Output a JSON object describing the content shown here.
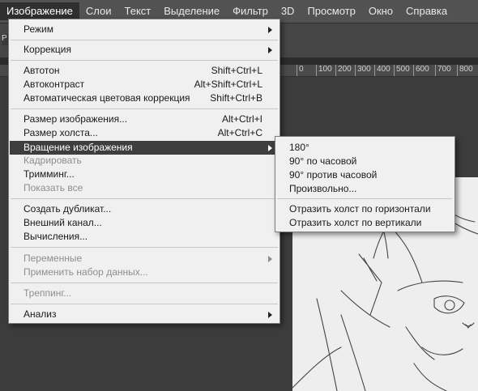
{
  "menubar": {
    "items": [
      "Изображение",
      "Слои",
      "Текст",
      "Выделение",
      "Фильтр",
      "3D",
      "Просмотр",
      "Окно",
      "Справка"
    ]
  },
  "options_stub": "Р",
  "ruler": {
    "ticks": [
      "0",
      "100",
      "200",
      "300",
      "400",
      "500",
      "600",
      "700",
      "800"
    ]
  },
  "image_menu": {
    "items": [
      {
        "label": "Режим",
        "shortcut": "",
        "submenu": true,
        "disabled": false
      },
      {
        "label": "Коррекция",
        "shortcut": "",
        "submenu": true,
        "disabled": false
      },
      {
        "label": "Автотон",
        "shortcut": "Shift+Ctrl+L",
        "submenu": false,
        "disabled": false
      },
      {
        "label": "Автоконтраст",
        "shortcut": "Alt+Shift+Ctrl+L",
        "submenu": false,
        "disabled": false
      },
      {
        "label": "Автоматическая цветовая коррекция",
        "shortcut": "Shift+Ctrl+B",
        "submenu": false,
        "disabled": false
      },
      {
        "label": "Размер изображения...",
        "shortcut": "Alt+Ctrl+I",
        "submenu": false,
        "disabled": false
      },
      {
        "label": "Размер холста...",
        "shortcut": "Alt+Ctrl+C",
        "submenu": false,
        "disabled": false
      },
      {
        "label": "Вращение изображения",
        "shortcut": "",
        "submenu": true,
        "disabled": false
      },
      {
        "label": "Кадрировать",
        "shortcut": "",
        "submenu": false,
        "disabled": true
      },
      {
        "label": "Тримминг...",
        "shortcut": "",
        "submenu": false,
        "disabled": false
      },
      {
        "label": "Показать все",
        "shortcut": "",
        "submenu": false,
        "disabled": true
      },
      {
        "label": "Создать дубликат...",
        "shortcut": "",
        "submenu": false,
        "disabled": false
      },
      {
        "label": "Внешний канал...",
        "shortcut": "",
        "submenu": false,
        "disabled": false
      },
      {
        "label": "Вычисления...",
        "shortcut": "",
        "submenu": false,
        "disabled": false
      },
      {
        "label": "Переменные",
        "shortcut": "",
        "submenu": true,
        "disabled": true
      },
      {
        "label": "Применить набор данных...",
        "shortcut": "",
        "submenu": false,
        "disabled": true
      },
      {
        "label": "Треппинг...",
        "shortcut": "",
        "submenu": false,
        "disabled": true
      },
      {
        "label": "Анализ",
        "shortcut": "",
        "submenu": true,
        "disabled": false
      }
    ]
  },
  "rotation_submenu": {
    "items": [
      {
        "label": "180°"
      },
      {
        "label": "90° по часовой"
      },
      {
        "label": "90° против часовой"
      },
      {
        "label": "Произвольно..."
      },
      {
        "label": "Отразить холст по горизонтали"
      },
      {
        "label": "Отразить холст по вертикали"
      }
    ]
  },
  "icons": {
    "submenu_arrow": "chevron-right-icon"
  }
}
